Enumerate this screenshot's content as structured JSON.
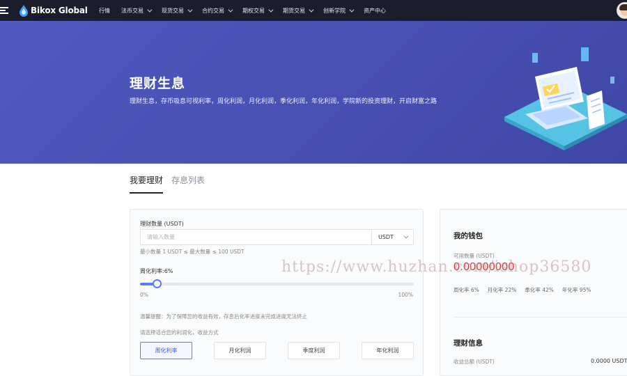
{
  "brand": {
    "name": "Bikox Global"
  },
  "nav": {
    "items": [
      {
        "label": "行情",
        "has_dropdown": false
      },
      {
        "label": "法币交易",
        "has_dropdown": true
      },
      {
        "label": "现货交易",
        "has_dropdown": true
      },
      {
        "label": "合约交易",
        "has_dropdown": true
      },
      {
        "label": "期权交易",
        "has_dropdown": true
      },
      {
        "label": "期货交易",
        "has_dropdown": true
      },
      {
        "label": "创新学院",
        "has_dropdown": true
      },
      {
        "label": "资产中心",
        "has_dropdown": false
      }
    ]
  },
  "banner": {
    "title": "理财生息",
    "subtitle": "理财生息，存币吸息可视利率，周化利润，月化利润，季化利润，年化利润，学院新的投资理财，开启财富之路"
  },
  "tabs": [
    {
      "label": "我要理财",
      "active": true
    },
    {
      "label": "存息列表",
      "active": false
    }
  ],
  "invest_form": {
    "amount_label": "理财数量 (USDT)",
    "amount_placeholder": "请输入数量",
    "unit": "USDT",
    "limit_hint": "最小数量 1 USDT ≤ 最大数量 ≤ 100 USDT",
    "rate_label": "周化利率:6%",
    "slider": {
      "value_fraction": 0.06,
      "min_label": "0%",
      "max_label": "100%"
    },
    "warning": "温馨提醒：为了保障您的收益有效，存息后化率进度未完成进度无法终止",
    "choose_label": "请选择适合您的利润化，收益方式",
    "periods": [
      {
        "label": "周化利率",
        "active": true
      },
      {
        "label": "月化利润",
        "active": false
      },
      {
        "label": "季度利润",
        "active": false
      },
      {
        "label": "年化利润",
        "active": false
      }
    ]
  },
  "wallet": {
    "title": "我的钱包",
    "available_label": "可用数量 (USDT)",
    "balance": "0.00000000",
    "rates": [
      "周化率 6%",
      "月化率 22%",
      "季化率 42%",
      "年化率 95%"
    ]
  },
  "finance_info": {
    "title": "理财信息",
    "total_label": "收益总额 (USDT)",
    "total_value": "0.0000 USDT"
  },
  "watermark": "https://www.huzhan.com/ishop36580",
  "colors": {
    "nav_bg": "#1b1c2c",
    "banner_bg": "#4a54b6",
    "accent": "#5b7ef0",
    "balance": "#e0303a"
  }
}
